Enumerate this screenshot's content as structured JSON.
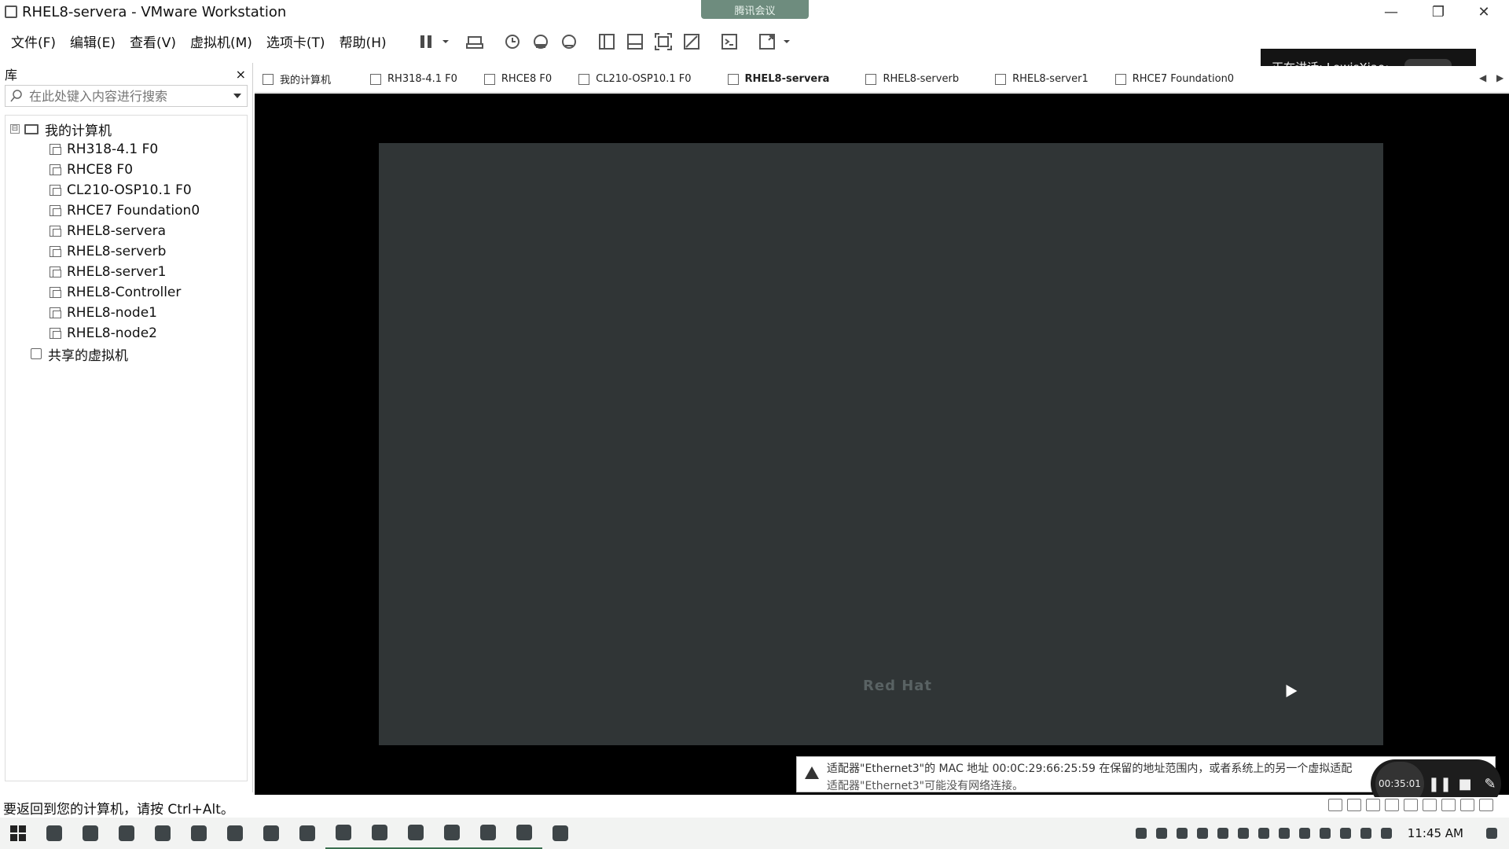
{
  "window": {
    "title": "RHEL8-servera - VMware Workstation",
    "meeting_label": "腾讯会议",
    "minimize": "—",
    "maximize": "❐",
    "close": "✕"
  },
  "menu": [
    "文件(F)",
    "编辑(E)",
    "查看(V)",
    "虚拟机(M)",
    "选项卡(T)",
    "帮助(H)"
  ],
  "toolbar_icons": [
    "pause-icon",
    "dropdown-icon",
    "send-keys-icon",
    "snapshot-icon",
    "revert-snapshot-icon",
    "snapshot-manager-icon",
    "library-view-icon",
    "thumbnail-icon",
    "fullscreen-icon",
    "unity-icon",
    "console-icon",
    "stretch-icon",
    "dropdown-icon"
  ],
  "speaking": {
    "label": "正在讲话: LewisXiao;"
  },
  "library": {
    "title": "库",
    "close": "×",
    "search_placeholder": "在此处键入内容进行搜索",
    "root": "我的计算机",
    "expander": "⊟",
    "items": [
      "RH318-4.1 F0",
      "RHCE8 F0",
      "CL210-OSP10.1 F0",
      "RHCE7 Foundation0",
      "RHEL8-servera",
      "RHEL8-serverb",
      "RHEL8-server1",
      "RHEL8-Controller",
      "RHEL8-node1",
      "RHEL8-node2"
    ],
    "shared": "共享的虚拟机"
  },
  "tabs": [
    {
      "label": "我的计算机",
      "active": false
    },
    {
      "label": "RH318-4.1 F0",
      "active": false
    },
    {
      "label": "RHCE8 F0",
      "active": false
    },
    {
      "label": "CL210-OSP10.1 F0",
      "active": false
    },
    {
      "label": "RHEL8-servera",
      "active": true
    },
    {
      "label": "RHEL8-serverb",
      "active": false
    },
    {
      "label": "RHEL8-server1",
      "active": false
    },
    {
      "label": "RHCE7 Foundation0",
      "active": false
    }
  ],
  "tab_scroll": {
    "left": "◀",
    "right": "▶"
  },
  "vm": {
    "screen_text": "Red Hat"
  },
  "notification": {
    "line1": "适配器\"Ethernet3\"的 MAC 地址 00:0C:29:66:25:59 在保留的地址范围内，或者系统上的另一个虚拟适配",
    "line2": "适配器\"Ethernet3\"可能没有网络连接。"
  },
  "recording": {
    "time": "00:35:01",
    "pause": "❚❚",
    "stop": "■",
    "edit": "✎"
  },
  "status": {
    "message": "要返回到您的计算机，请按 Ctrl+Alt。"
  },
  "taskbar": {
    "clock": "11:45 AM"
  },
  "colors": {
    "vm_screen": "#303536",
    "vm_background": "#000000",
    "meeting_tab": "#6e8c7e",
    "speaking_overlay": "#141414"
  }
}
